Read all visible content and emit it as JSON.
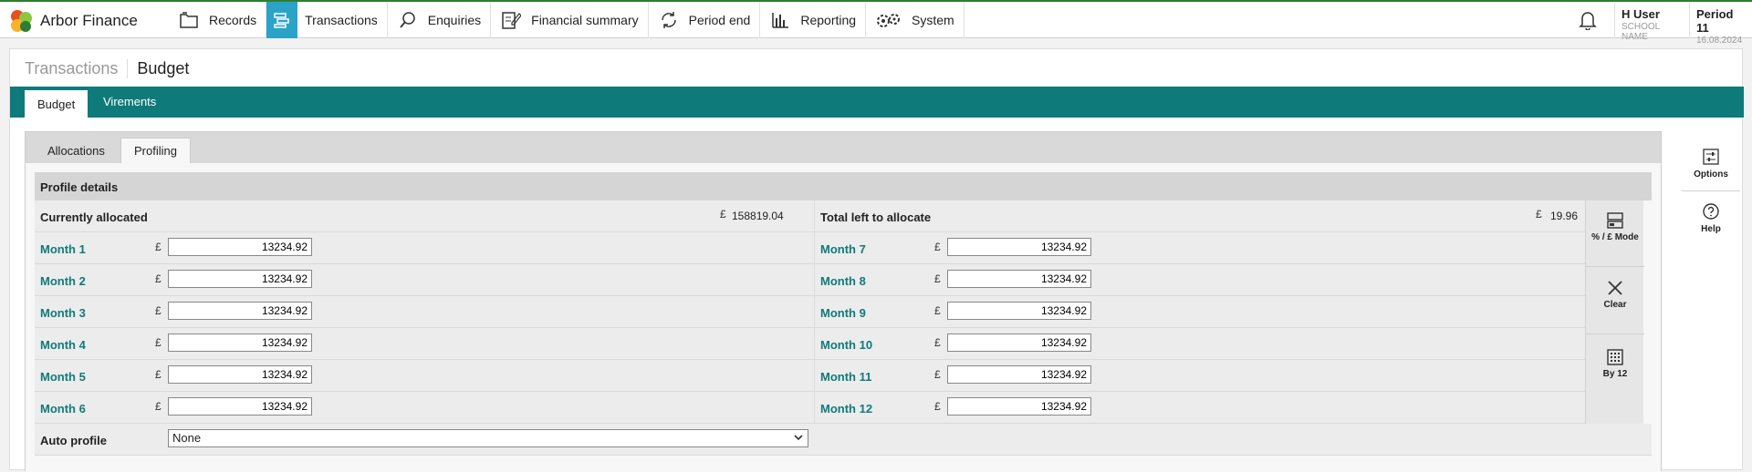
{
  "brand": {
    "name": "Arbor Finance"
  },
  "nav": [
    {
      "label": "Records",
      "icon": "folder-icon"
    },
    {
      "label": "Transactions",
      "icon": "transactions-icon",
      "active": true
    },
    {
      "label": "Enquiries",
      "icon": "search-icon"
    },
    {
      "label": "Financial summary",
      "icon": "document-edit-icon"
    },
    {
      "label": "Period end",
      "icon": "cycle-icon"
    },
    {
      "label": "Reporting",
      "icon": "bar-chart-icon"
    },
    {
      "label": "System",
      "icon": "gears-icon"
    }
  ],
  "user": {
    "name": "H User",
    "school": "SCHOOL NAME"
  },
  "period": {
    "name": "Period 11",
    "date": "16.08.2024"
  },
  "page": {
    "breadcrumb": "Transactions",
    "title": "Budget"
  },
  "main_tabs": [
    {
      "label": "Budget"
    },
    {
      "label": "Virements"
    }
  ],
  "sub_tabs": [
    {
      "label": "Allocations"
    },
    {
      "label": "Profiling"
    }
  ],
  "profile": {
    "heading": "Profile details",
    "currently_allocated_label": "Currently allocated",
    "currently_allocated_value": "158819.04",
    "left_label": "Total left to allocate",
    "left_value": "19.96",
    "currency": "£",
    "months_left": [
      {
        "label": "Month 1",
        "value": "13234.92"
      },
      {
        "label": "Month 2",
        "value": "13234.92"
      },
      {
        "label": "Month 3",
        "value": "13234.92"
      },
      {
        "label": "Month 4",
        "value": "13234.92"
      },
      {
        "label": "Month 5",
        "value": "13234.92"
      },
      {
        "label": "Month 6",
        "value": "13234.92"
      }
    ],
    "months_right": [
      {
        "label": "Month 7",
        "value": "13234.92"
      },
      {
        "label": "Month 8",
        "value": "13234.92"
      },
      {
        "label": "Month 9",
        "value": "13234.92"
      },
      {
        "label": "Month 10",
        "value": "13234.92"
      },
      {
        "label": "Month 11",
        "value": "13234.92"
      },
      {
        "label": "Month 12",
        "value": "13234.92"
      }
    ],
    "auto_profile_label": "Auto profile",
    "auto_profile_value": "None"
  },
  "actions": [
    {
      "label": "% / £ Mode",
      "icon": "mode-toggle-icon"
    },
    {
      "label": "Clear",
      "icon": "close-icon"
    },
    {
      "label": "By 12",
      "icon": "grid-icon"
    }
  ],
  "rail": [
    {
      "label": "Options",
      "icon": "options-icon"
    },
    {
      "label": "Help",
      "icon": "help-icon"
    }
  ],
  "colors": {
    "teal": "#0f7a7a",
    "active_nav": "#2ba3c9",
    "month_label": "#0f7a7a"
  }
}
